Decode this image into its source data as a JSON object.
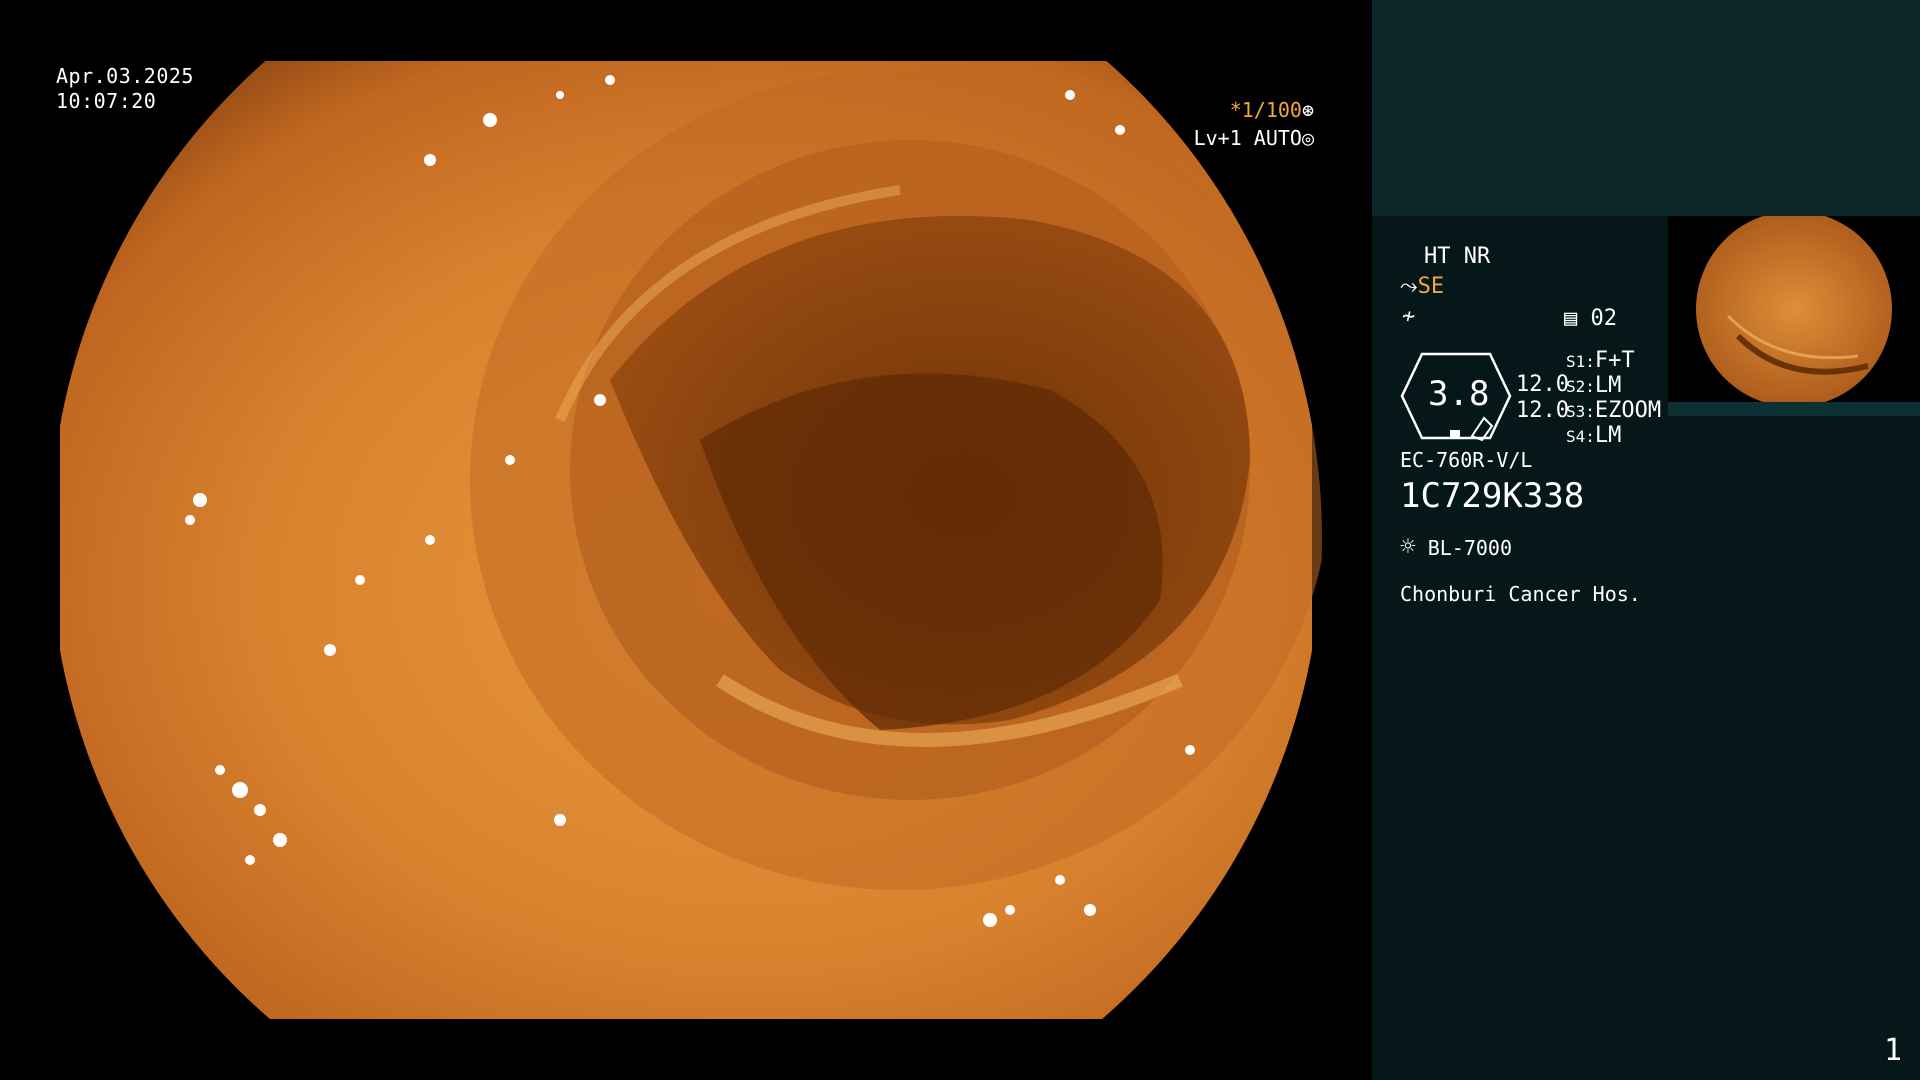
{
  "overlay": {
    "date": "Apr.03.2025",
    "time": "10:07:20",
    "shutter": "*1/100",
    "iris": "Lv+1 AUTO"
  },
  "panel": {
    "ht_nr": "HT NR",
    "se": "SE",
    "memory": "02",
    "zoom_value": "3.8",
    "value_1": "12.0",
    "value_2": "12.0",
    "s1_label": "S1:",
    "s1_value": "F+T",
    "s2_label": "S2:",
    "s2_value": "LM",
    "s3_label": "S3:",
    "s3_value": "EZOOM",
    "s4_label": "S4:",
    "s4_value": "LM",
    "scope_model": "EC-760R-V/L",
    "serial": "1C729K338",
    "light_source": "BL-7000",
    "hospital": "Chonburi Cancer Hos."
  },
  "page_number": "1",
  "colors": {
    "accent": "#f0a83a",
    "panel_bg": "#06171a",
    "panel_top_bg": "#0b2628"
  },
  "icons": [
    "shutter-icon",
    "iris-icon",
    "scope-icon",
    "freeze-icon",
    "memory-icon",
    "light-icon",
    "dial-icon"
  ]
}
